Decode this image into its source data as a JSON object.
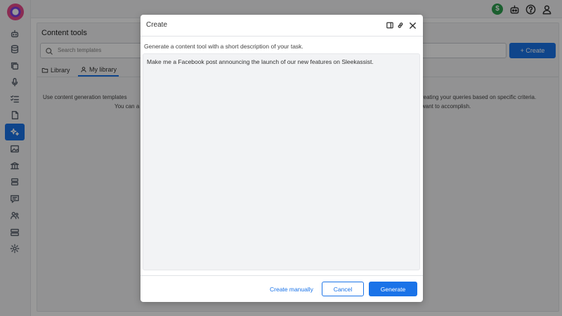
{
  "sidebar": {
    "icons": [
      "robot-icon",
      "database-icon",
      "copy-icon",
      "microphone-icon",
      "checklist-icon",
      "document-icon",
      "sparkles-icon",
      "image-icon",
      "bank-icon",
      "stack-icon",
      "chat-icon",
      "users-icon",
      "server-icon",
      "gear-icon"
    ],
    "active_index": 6
  },
  "topbar": {
    "credit_symbol": "$",
    "icons": [
      "credit-icon",
      "robot-icon",
      "help-icon",
      "user-icon"
    ]
  },
  "page": {
    "title": "Content tools",
    "search_placeholder": "Search templates",
    "create_label": "+ Create",
    "tabs": [
      {
        "label": "Library",
        "active": false
      },
      {
        "label": "My library",
        "active": true
      }
    ],
    "description_left_1": "Use content generation templates",
    "description_left_2": "You can a",
    "description_right_1": "reating your queries based on specific criteria.",
    "description_right_2": "want to accomplish."
  },
  "modal": {
    "title": "Create",
    "instruction": "Generate a content tool with a short description of your task.",
    "prompt_value": "Make me a Facebook post announcing the launch of our new features on Sleekassist.",
    "buttons": {
      "manual": "Create manually",
      "cancel": "Cancel",
      "generate": "Generate"
    }
  },
  "colors": {
    "accent": "#1a73e8",
    "credit": "#2e9e4f"
  }
}
